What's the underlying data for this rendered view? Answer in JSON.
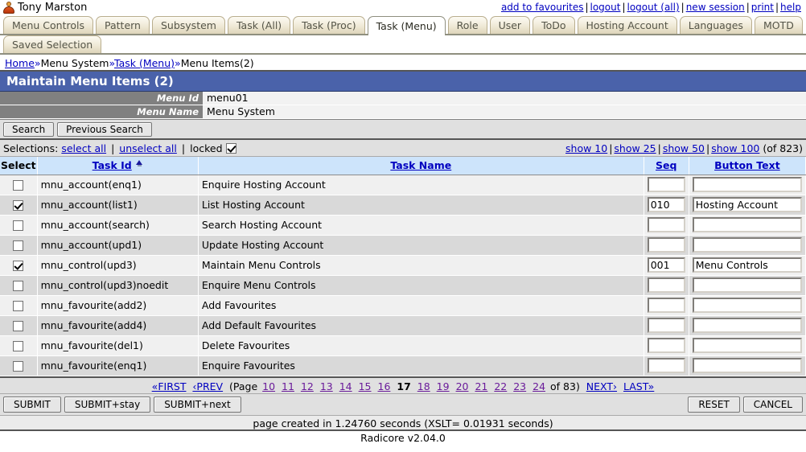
{
  "header": {
    "username": "Tony Marston",
    "links": [
      {
        "label": "add to favourites"
      },
      {
        "label": "logout"
      },
      {
        "label": "logout (all)"
      },
      {
        "label": "new session"
      },
      {
        "label": "print"
      },
      {
        "label": "help"
      }
    ]
  },
  "tabs_row1": [
    {
      "label": "Menu Controls",
      "active": false
    },
    {
      "label": "Pattern",
      "active": false
    },
    {
      "label": "Subsystem",
      "active": false
    },
    {
      "label": "Task (All)",
      "active": false
    },
    {
      "label": "Task (Proc)",
      "active": false
    },
    {
      "label": "Task (Menu)",
      "active": true
    },
    {
      "label": "Role",
      "active": false
    },
    {
      "label": "User",
      "active": false
    },
    {
      "label": "ToDo",
      "active": false
    },
    {
      "label": "Hosting Account",
      "active": false
    },
    {
      "label": "Languages",
      "active": false
    },
    {
      "label": "MOTD",
      "active": false
    }
  ],
  "tabs_row2": [
    {
      "label": "Saved Selection",
      "active": false
    }
  ],
  "breadcrumb": {
    "items": [
      "Home",
      "Menu System",
      "Task (Menu)",
      "Menu Items(2)"
    ],
    "separator": "»"
  },
  "page_title": "Maintain Menu Items (2)",
  "key_fields": [
    {
      "label": "Menu Id",
      "value": "menu01"
    },
    {
      "label": "Menu Name",
      "value": "Menu System"
    }
  ],
  "search_bar": {
    "search_label": "Search",
    "previous_search_label": "Previous Search"
  },
  "selections": {
    "label": "Selections:",
    "select_all": "select all",
    "unselect_all": "unselect all",
    "locked_label": "locked",
    "locked_checked": true,
    "show_options": [
      "show 10",
      "show 25",
      "show 50",
      "show 100"
    ],
    "total_text": "(of 823)"
  },
  "table": {
    "columns": [
      "Select",
      "Task Id",
      "Task Name",
      "Seq",
      "Button Text"
    ],
    "sort_column": "Task Id",
    "rows": [
      {
        "selected": false,
        "task_id": "mnu_account(enq1)",
        "task_name": "Enquire Hosting Account",
        "seq": "",
        "button_text": ""
      },
      {
        "selected": true,
        "task_id": "mnu_account(list1)",
        "task_name": "List Hosting Account",
        "seq": "010",
        "button_text": "Hosting Account"
      },
      {
        "selected": false,
        "task_id": "mnu_account(search)",
        "task_name": "Search Hosting Account",
        "seq": "",
        "button_text": ""
      },
      {
        "selected": false,
        "task_id": "mnu_account(upd1)",
        "task_name": "Update Hosting Account",
        "seq": "",
        "button_text": ""
      },
      {
        "selected": true,
        "task_id": "mnu_control(upd3)",
        "task_name": "Maintain Menu Controls",
        "seq": "001",
        "button_text": "Menu Controls"
      },
      {
        "selected": false,
        "task_id": "mnu_control(upd3)noedit",
        "task_name": "Enquire Menu Controls",
        "seq": "",
        "button_text": ""
      },
      {
        "selected": false,
        "task_id": "mnu_favourite(add2)",
        "task_name": "Add Favourites",
        "seq": "",
        "button_text": ""
      },
      {
        "selected": false,
        "task_id": "mnu_favourite(add4)",
        "task_name": "Add Default Favourites",
        "seq": "",
        "button_text": ""
      },
      {
        "selected": false,
        "task_id": "mnu_favourite(del1)",
        "task_name": "Delete Favourites",
        "seq": "",
        "button_text": ""
      },
      {
        "selected": false,
        "task_id": "mnu_favourite(enq1)",
        "task_name": "Enquire Favourites",
        "seq": "",
        "button_text": ""
      }
    ]
  },
  "pager": {
    "first": "«FIRST",
    "prev": "‹PREV",
    "page_label": "(Page",
    "pages": [
      "10",
      "11",
      "12",
      "13",
      "14",
      "15",
      "16",
      "17",
      "18",
      "19",
      "20",
      "21",
      "22",
      "23",
      "24"
    ],
    "current_page": "17",
    "of_label": "of 83)",
    "next": "NEXT›",
    "last": "LAST»"
  },
  "actions": {
    "submit": "SUBMIT",
    "submit_stay": "SUBMIT+stay",
    "submit_next": "SUBMIT+next",
    "reset": "RESET",
    "cancel": "CANCEL"
  },
  "footer": {
    "timing": "page created in 1.24760 seconds (XSLT= 0.01931 seconds)",
    "version": "Radicore v2.04.0"
  }
}
